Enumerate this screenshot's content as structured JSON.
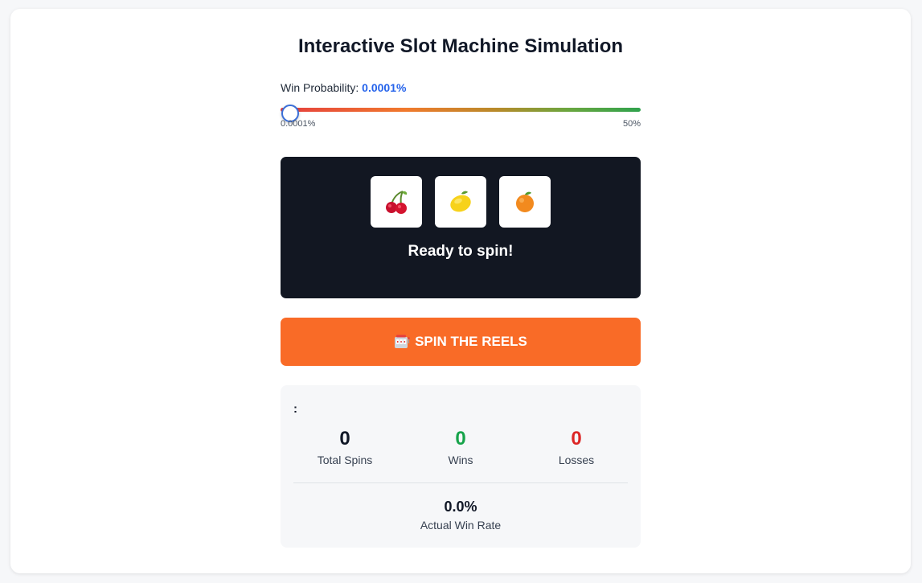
{
  "title": "Interactive Slot Machine Simulation",
  "probability": {
    "label": "Win Probability:",
    "value_text": "0.0001%",
    "min_label": "0.0001%",
    "max_label": "50%",
    "slider_level": 0.0
  },
  "machine": {
    "reels": [
      {
        "icon": "cherry-icon"
      },
      {
        "icon": "lemon-icon"
      },
      {
        "icon": "orange-icon"
      }
    ],
    "status": "Ready to spin!"
  },
  "spin_button": {
    "label": "SPIN THE REELS",
    "icon": "slot-machine-icon"
  },
  "stats": {
    "heading": ":",
    "total_spins": {
      "value": "0",
      "label": "Total Spins"
    },
    "wins": {
      "value": "0",
      "label": "Wins"
    },
    "losses": {
      "value": "0",
      "label": "Losses"
    },
    "actual_rate": {
      "value": "0.0%",
      "label": "Actual Win Rate"
    }
  },
  "colors": {
    "accent": "#2563eb",
    "spin_button": "#f96b27",
    "win": "#16a34a",
    "loss": "#dc2626",
    "machine_bg": "#121722"
  }
}
